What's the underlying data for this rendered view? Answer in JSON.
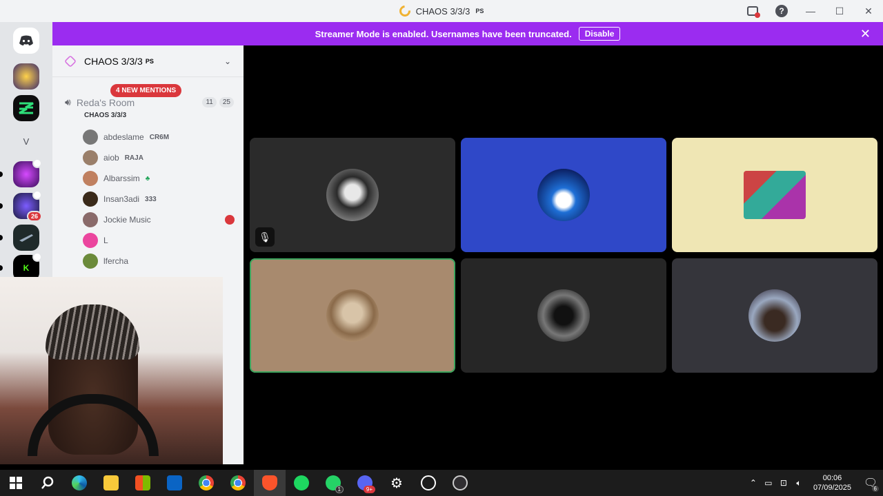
{
  "window": {
    "title": "CHAOS 3/3/3",
    "title_suffix": "PS",
    "titlebar_icons": [
      "inbox-icon",
      "help-icon"
    ],
    "help_glyph": "?",
    "minimize": "—",
    "maximize": "☐",
    "close": "✕"
  },
  "banner": {
    "text": "Streamer Mode is enabled. Usernames have been truncated.",
    "button": "Disable",
    "close": "✕"
  },
  "guilds": {
    "v_label": "V",
    "badge_count": "26"
  },
  "server": {
    "name": "CHAOS 3/3/3",
    "suffix": "PS",
    "chevron": "⌄"
  },
  "mentions": "4 NEW MENTIONS",
  "voice_channel": {
    "name": "Reda's Room",
    "subtitle": "CHAOS 3/3/3",
    "video_count": "11",
    "user_limit": "25"
  },
  "members": [
    {
      "name": "abdeslame",
      "tag": "CR6M"
    },
    {
      "name": "aiob",
      "tag": "RAJA"
    },
    {
      "name": "Albarssim",
      "tag": ""
    },
    {
      "name": "Insan3adi",
      "tag": "333"
    },
    {
      "name": "Jockie Music",
      "tag": ""
    },
    {
      "name": "L",
      "tag": ""
    },
    {
      "name": "lfercha",
      "tag": ""
    }
  ],
  "tiles": [
    {
      "bg": "#2b2b2b",
      "muted": true
    },
    {
      "bg": "#2f48c8",
      "muted": false
    },
    {
      "bg": "#efe6b4",
      "muted": false
    },
    {
      "bg": "#a88a6e",
      "muted": false,
      "speaking": true
    },
    {
      "bg": "#262626",
      "muted": false
    },
    {
      "bg": "#35353b",
      "muted": false
    }
  ],
  "taskbar": {
    "apps": [
      "start-icon",
      "search-icon",
      "edge-icon",
      "file-explorer-icon",
      "store-icon",
      "outlook-icon",
      "chrome-icon",
      "chrome-profile-icon",
      "brave-icon",
      "spotify-icon",
      "whatsapp-icon",
      "discord-icon",
      "settings-icon",
      "chatgpt-icon",
      "obs-icon"
    ],
    "whatsapp_badge": "1",
    "discord_badge": "9+",
    "clock_time": "00:06",
    "clock_date": "07/09/2025",
    "notification_count": "6"
  },
  "colors": {
    "banner": "#9b2cf0",
    "mention_red": "#da373c",
    "speaking_green": "#3ba55d"
  }
}
